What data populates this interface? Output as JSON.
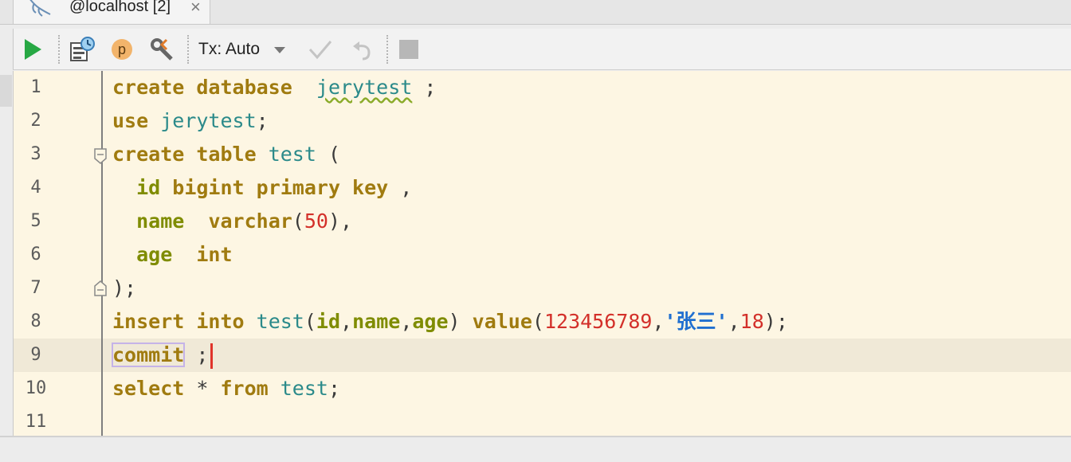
{
  "tab": {
    "title": "@localhost [2]",
    "close": "×"
  },
  "toolbar": {
    "run_icon": "play-icon",
    "explain_icon": "explain-plan-icon",
    "profile_label": "p",
    "settings_icon": "wrench-icon",
    "tx_label": "Tx: Auto",
    "commit_icon": "checkmark-icon",
    "rollback_icon": "undo-icon",
    "stop_icon": "stop-icon"
  },
  "colors": {
    "keyword": "#a07b10",
    "column": "#7f8c00",
    "identifier": "#2b8a8a",
    "number": "#d3302a",
    "string": "#1f6fd0",
    "editor_bg": "#fdf6e3"
  },
  "editor": {
    "current_line": 9,
    "lines": [
      {
        "n": "1",
        "t": [
          [
            "kw",
            "create database"
          ],
          [
            "p",
            "  "
          ],
          [
            "id squig",
            "jerytest"
          ],
          [
            "p",
            " ;"
          ]
        ]
      },
      {
        "n": "2",
        "t": [
          [
            "kw",
            "use"
          ],
          [
            "p",
            " "
          ],
          [
            "id",
            "jerytest"
          ],
          [
            "p",
            ";"
          ]
        ]
      },
      {
        "n": "3",
        "t": [
          [
            "kw",
            "create table"
          ],
          [
            "p",
            " "
          ],
          [
            "id",
            "test"
          ],
          [
            "p",
            " ("
          ]
        ]
      },
      {
        "n": "4",
        "t": [
          [
            "p",
            "  "
          ],
          [
            "col",
            "id"
          ],
          [
            "p",
            " "
          ],
          [
            "kw",
            "bigint primary key"
          ],
          [
            "p",
            " ,"
          ]
        ]
      },
      {
        "n": "5",
        "t": [
          [
            "p",
            "  "
          ],
          [
            "col",
            "name"
          ],
          [
            "p",
            "  "
          ],
          [
            "kw",
            "varchar"
          ],
          [
            "p",
            "("
          ],
          [
            "num",
            "50"
          ],
          [
            "p",
            "),"
          ]
        ]
      },
      {
        "n": "6",
        "t": [
          [
            "p",
            "  "
          ],
          [
            "col",
            "age"
          ],
          [
            "p",
            "  "
          ],
          [
            "kw",
            "int"
          ]
        ]
      },
      {
        "n": "7",
        "t": [
          [
            "p",
            ");"
          ]
        ]
      },
      {
        "n": "8",
        "t": [
          [
            "kw",
            "insert into"
          ],
          [
            "p",
            " "
          ],
          [
            "id",
            "test"
          ],
          [
            "p",
            "("
          ],
          [
            "col",
            "id"
          ],
          [
            "p",
            ","
          ],
          [
            "col",
            "name"
          ],
          [
            "p",
            ","
          ],
          [
            "col",
            "age"
          ],
          [
            "p",
            ") "
          ],
          [
            "kw",
            "value"
          ],
          [
            "p",
            "("
          ],
          [
            "num",
            "123456789"
          ],
          [
            "p",
            ","
          ],
          [
            "str",
            "'张三'"
          ],
          [
            "p",
            ","
          ],
          [
            "num",
            "18"
          ],
          [
            "p",
            ");"
          ]
        ]
      },
      {
        "n": "9",
        "t": [
          [
            "kw hl",
            "commit"
          ],
          [
            "p",
            " ;"
          ]
        ]
      },
      {
        "n": "10",
        "t": [
          [
            "kw",
            "select"
          ],
          [
            "p",
            " * "
          ],
          [
            "kw",
            "from"
          ],
          [
            "p",
            " "
          ],
          [
            "id",
            "test"
          ],
          [
            "p",
            ";"
          ]
        ]
      },
      {
        "n": "11",
        "t": []
      }
    ]
  }
}
